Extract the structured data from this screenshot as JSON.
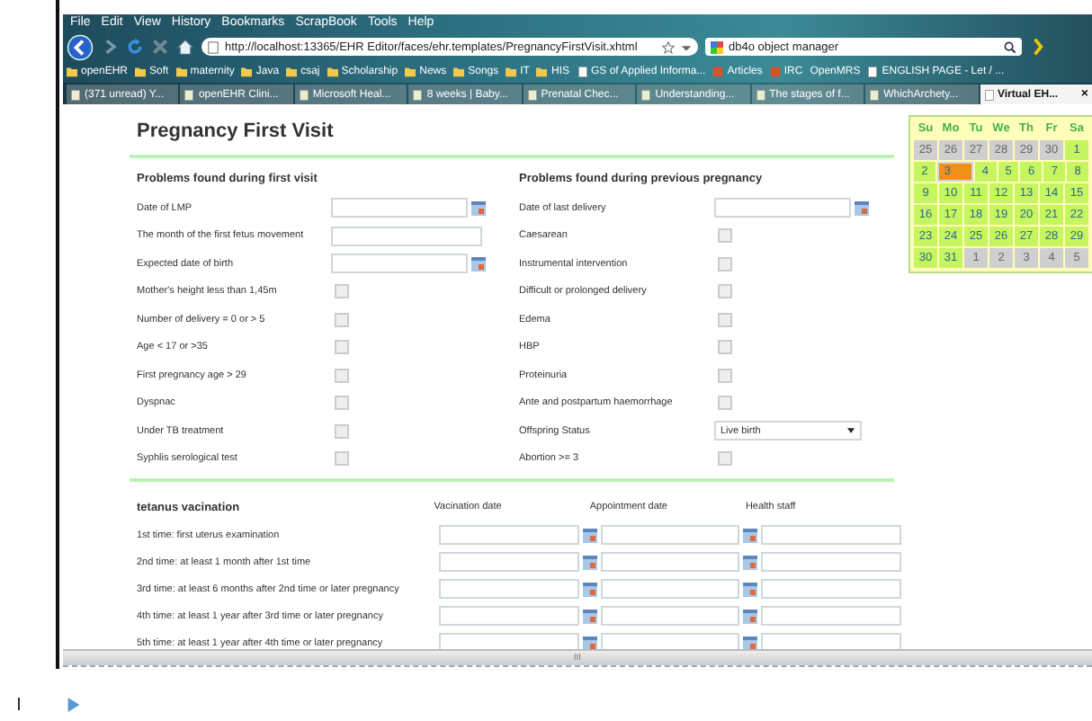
{
  "menu": [
    "File",
    "Edit",
    "View",
    "History",
    "Bookmarks",
    "ScrapBook",
    "Tools",
    "Help"
  ],
  "address": {
    "value": "http://localhost:13365/EHR Editor/faces/ehr.templates/PregnancyFirstVisit.xhtml"
  },
  "search": {
    "value": "db4o object manager"
  },
  "bookmarks": [
    {
      "label": "openEHR",
      "kind": "folder"
    },
    {
      "label": "Soft",
      "kind": "folder"
    },
    {
      "label": "maternity",
      "kind": "folder"
    },
    {
      "label": "Java",
      "kind": "folder"
    },
    {
      "label": "csaj",
      "kind": "folder"
    },
    {
      "label": "Scholarship",
      "kind": "folder"
    },
    {
      "label": "News",
      "kind": "folder"
    },
    {
      "label": "Songs",
      "kind": "folder"
    },
    {
      "label": "IT",
      "kind": "folder"
    },
    {
      "label": "HIS",
      "kind": "folder"
    },
    {
      "label": "GS of Applied Informa...",
      "kind": "page"
    },
    {
      "label": "Articles",
      "kind": "site"
    },
    {
      "label": "IRC",
      "kind": "site"
    },
    {
      "label": "OpenMRS",
      "kind": "plain"
    },
    {
      "label": "ENGLISH PAGE - Let / ...",
      "kind": "page"
    }
  ],
  "tabs": [
    {
      "label": "(371 unread) Y...",
      "selected": false
    },
    {
      "label": "openEHR Clini...",
      "selected": false
    },
    {
      "label": "Microsoft Heal...",
      "selected": false
    },
    {
      "label": "8 weeks | Baby...",
      "selected": false
    },
    {
      "label": "Prenatal Chec...",
      "selected": false
    },
    {
      "label": "Understanding...",
      "selected": false
    },
    {
      "label": "The stages of f...",
      "selected": false
    },
    {
      "label": "WhichArchety...",
      "selected": false
    },
    {
      "label": "Virtual EH...",
      "selected": true
    }
  ],
  "tab_close": "×",
  "page_title": "Pregnancy First Visit",
  "sections": [
    {
      "title": "Problems found during first visit",
      "rows": [
        {
          "label": "Date of LMP",
          "kind": "date"
        },
        {
          "label": "The month of the first fetus movement",
          "kind": "text"
        },
        {
          "label": "Expected date of birth",
          "kind": "date"
        },
        {
          "label": "Mother's height less than 1,45m",
          "kind": "checkbox",
          "checked": false
        },
        {
          "label": "Number of delivery = 0 or > 5",
          "kind": "checkbox",
          "checked": false
        },
        {
          "label": "Age < 17 or >35",
          "kind": "checkbox",
          "checked": false
        },
        {
          "label": "First pregnancy age > 29",
          "kind": "checkbox",
          "checked": false
        },
        {
          "label": "Dyspnac",
          "kind": "checkbox",
          "checked": false
        },
        {
          "label": "Under TB treatment",
          "kind": "checkbox",
          "checked": false
        },
        {
          "label": "Syphlis serological test",
          "kind": "checkbox",
          "checked": false
        }
      ]
    },
    {
      "title": "Problems found during previous pregnancy",
      "rows": [
        {
          "label": "Date of last delivery",
          "kind": "date"
        },
        {
          "label": "Caesarean",
          "kind": "checkbox",
          "checked": false
        },
        {
          "label": "Instrumental intervention",
          "kind": "checkbox",
          "checked": false
        },
        {
          "label": "Difficult or prolonged delivery",
          "kind": "checkbox",
          "checked": false
        },
        {
          "label": "Edema",
          "kind": "checkbox",
          "checked": false
        },
        {
          "label": "HBP",
          "kind": "checkbox",
          "checked": false
        },
        {
          "label": "Proteinuria",
          "kind": "checkbox",
          "checked": false
        },
        {
          "label": "Ante and postpartum haemorrhage",
          "kind": "checkbox",
          "checked": false
        },
        {
          "label": "Offspring Status",
          "kind": "select",
          "value": "Live birth"
        },
        {
          "label": "Abortion >= 3",
          "kind": "checkbox",
          "checked": false
        }
      ]
    }
  ],
  "vaccination": {
    "title": "tetanus vacination",
    "columns": [
      "Vacination date",
      "Appointment date",
      "Health staff"
    ],
    "rows": [
      "1st time: first uterus examination",
      "2nd time: at least 1 month after 1st time",
      "3rd time: at least 6 months after 2nd time or later pregnancy",
      "4th time: at least 1 year after 3rd time or later pregnancy",
      "5th time: at least 1 year after 4th time or later pregnancy"
    ]
  },
  "calendar": {
    "weekdays": [
      "Su",
      "Mo",
      "Tu",
      "We",
      "Th",
      "Fr",
      "Sa"
    ],
    "weeks": [
      [
        {
          "day": "25",
          "other_month": true,
          "selected": false
        },
        {
          "day": "26",
          "other_month": true,
          "selected": false
        },
        {
          "day": "27",
          "other_month": true,
          "selected": false
        },
        {
          "day": "28",
          "other_month": true,
          "selected": false
        },
        {
          "day": "29",
          "other_month": true,
          "selected": false
        },
        {
          "day": "30",
          "other_month": true,
          "selected": false
        },
        {
          "day": "1",
          "other_month": false,
          "selected": false
        }
      ],
      [
        {
          "day": "2",
          "other_month": false,
          "selected": false
        },
        {
          "day": "3",
          "other_month": false,
          "selected": true
        },
        {
          "day": "4",
          "other_month": false,
          "selected": false
        },
        {
          "day": "5",
          "other_month": false,
          "selected": false
        },
        {
          "day": "6",
          "other_month": false,
          "selected": false
        },
        {
          "day": "7",
          "other_month": false,
          "selected": false
        },
        {
          "day": "8",
          "other_month": false,
          "selected": false
        }
      ],
      [
        {
          "day": "9",
          "other_month": false,
          "selected": false
        },
        {
          "day": "10",
          "other_month": false,
          "selected": false
        },
        {
          "day": "11",
          "other_month": false,
          "selected": false
        },
        {
          "day": "12",
          "other_month": false,
          "selected": false
        },
        {
          "day": "13",
          "other_month": false,
          "selected": false
        },
        {
          "day": "14",
          "other_month": false,
          "selected": false
        },
        {
          "day": "15",
          "other_month": false,
          "selected": false
        }
      ],
      [
        {
          "day": "16",
          "other_month": false,
          "selected": false
        },
        {
          "day": "17",
          "other_month": false,
          "selected": false
        },
        {
          "day": "18",
          "other_month": false,
          "selected": false
        },
        {
          "day": "19",
          "other_month": false,
          "selected": false
        },
        {
          "day": "20",
          "other_month": false,
          "selected": false
        },
        {
          "day": "21",
          "other_month": false,
          "selected": false
        },
        {
          "day": "22",
          "other_month": false,
          "selected": false
        }
      ],
      [
        {
          "day": "23",
          "other_month": false,
          "selected": false
        },
        {
          "day": "24",
          "other_month": false,
          "selected": false
        },
        {
          "day": "25",
          "other_month": false,
          "selected": false
        },
        {
          "day": "26",
          "other_month": false,
          "selected": false
        },
        {
          "day": "27",
          "other_month": false,
          "selected": false
        },
        {
          "day": "28",
          "other_month": false,
          "selected": false
        },
        {
          "day": "29",
          "other_month": false,
          "selected": false
        }
      ],
      [
        {
          "day": "30",
          "other_month": false,
          "selected": false
        },
        {
          "day": "31",
          "other_month": false,
          "selected": false
        },
        {
          "day": "1",
          "other_month": true,
          "selected": false
        },
        {
          "day": "2",
          "other_month": true,
          "selected": false
        },
        {
          "day": "3",
          "other_month": true,
          "selected": false
        },
        {
          "day": "4",
          "other_month": true,
          "selected": false
        },
        {
          "day": "5",
          "other_month": true,
          "selected": false
        }
      ]
    ]
  },
  "scrollbar_grip": "III"
}
